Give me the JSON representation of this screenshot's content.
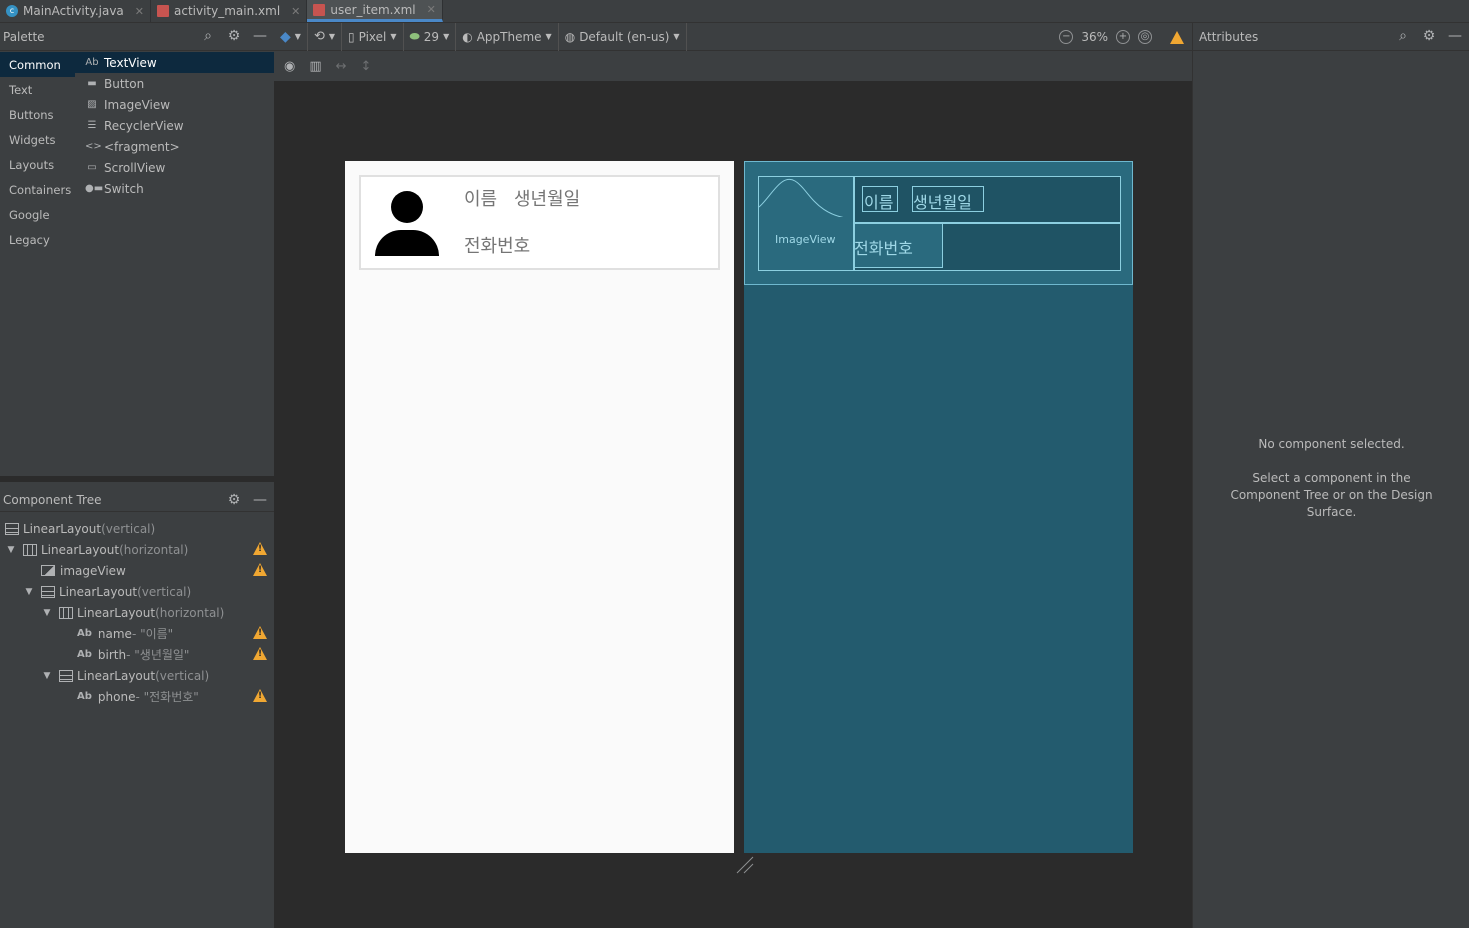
{
  "tabs": [
    {
      "label": "MainActivity.java",
      "type": "java",
      "active": false
    },
    {
      "label": "activity_main.xml",
      "type": "xml",
      "active": false
    },
    {
      "label": "user_item.xml",
      "type": "xml",
      "active": true
    }
  ],
  "palette": {
    "title": "Palette",
    "categories": [
      "Common",
      "Text",
      "Buttons",
      "Widgets",
      "Layouts",
      "Containers",
      "Google",
      "Legacy"
    ],
    "items": [
      {
        "icon": "Ab",
        "label": "TextView"
      },
      {
        "icon": "button-icon",
        "label": "Button"
      },
      {
        "icon": "image-icon",
        "label": "ImageView"
      },
      {
        "icon": "list-icon",
        "label": "RecyclerView"
      },
      {
        "icon": "code-icon",
        "label": "<fragment>"
      },
      {
        "icon": "scroll-icon",
        "label": "ScrollView"
      },
      {
        "icon": "switch-icon",
        "label": "Switch"
      }
    ]
  },
  "component_tree": {
    "title": "Component Tree",
    "rows": [
      {
        "name": "LinearLayout",
        "detail": "(vertical)"
      },
      {
        "name": "LinearLayout",
        "detail": "(horizontal)"
      },
      {
        "name": "imageView",
        "detail": ""
      },
      {
        "name": "LinearLayout",
        "detail": "(vertical)"
      },
      {
        "name": "LinearLayout",
        "detail": "(horizontal)"
      },
      {
        "name": "name",
        "detail": "- \"이름\""
      },
      {
        "name": "birth",
        "detail": "- \"생년월일\""
      },
      {
        "name": "LinearLayout",
        "detail": "(vertical)"
      },
      {
        "name": "phone",
        "detail": "- \"전화번호\""
      }
    ]
  },
  "toolbar": {
    "device": "Pixel",
    "api": "29",
    "theme": "AppTheme",
    "locale": "Default (en-us)",
    "zoom": "36%"
  },
  "preview": {
    "name": "이름",
    "birth": "생년월일",
    "phone": "전화번호",
    "imageview_label": "ImageView"
  },
  "attributes": {
    "title": "Attributes",
    "empty_title": "No component selected.",
    "empty_hint": "Select a component in the Component Tree or on the Design Surface."
  },
  "colors": {
    "accent": "#4a88c7",
    "selection": "#0d293e",
    "blueprint": "#235b6e",
    "warning": "#f0a732"
  }
}
